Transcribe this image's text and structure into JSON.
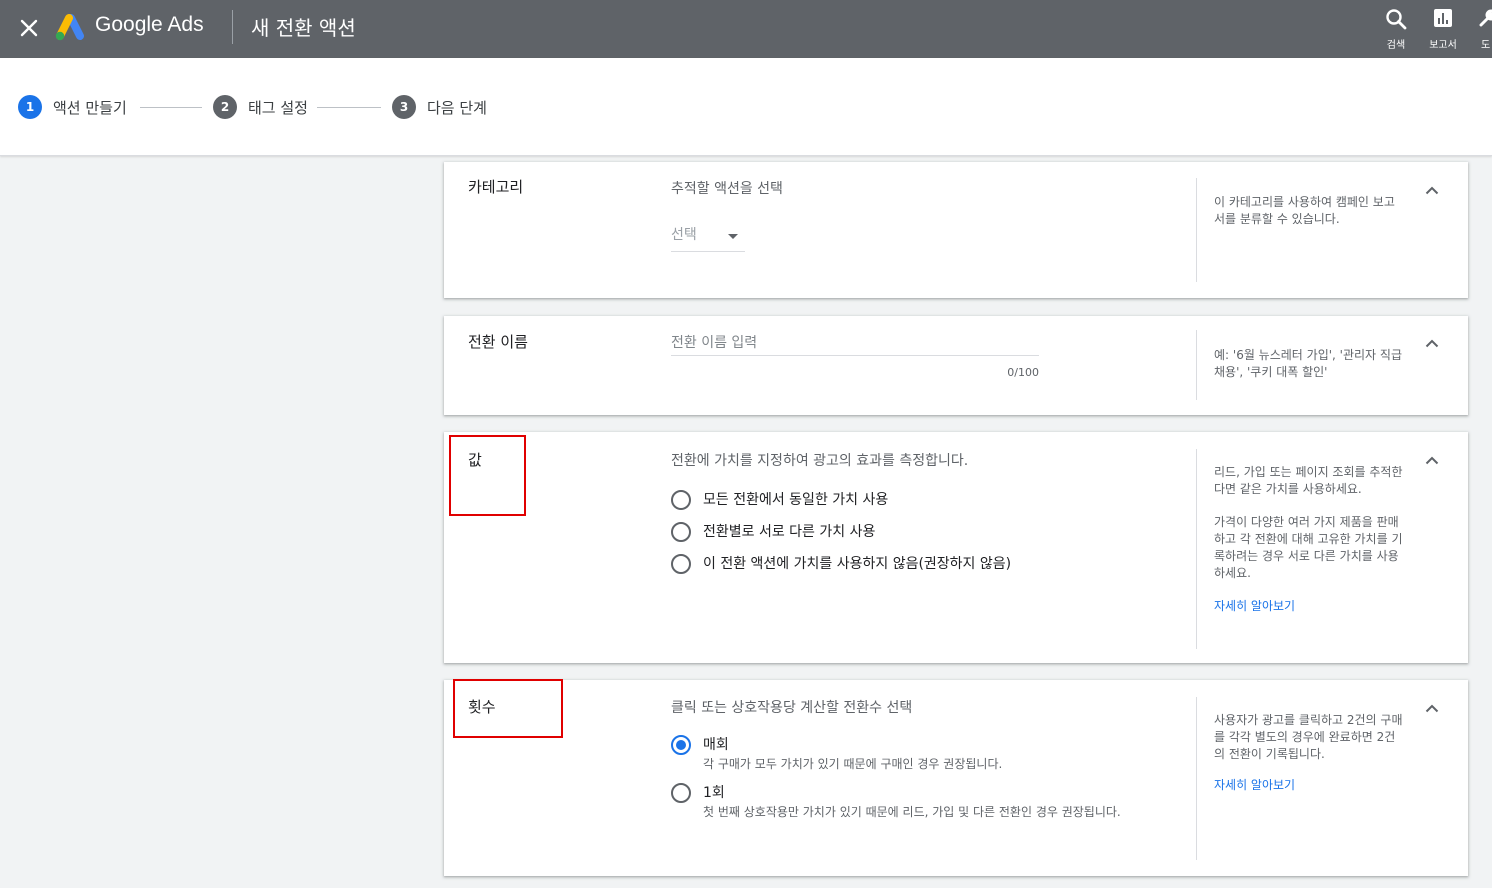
{
  "header": {
    "close_icon": "close-icon",
    "brand": "Google Ads",
    "page_title": "새 전환 액션",
    "tools": [
      {
        "icon": "search-icon",
        "label": "검색"
      },
      {
        "icon": "reports-icon",
        "label": "보고서"
      },
      {
        "icon": "tools-icon",
        "label": "도"
      }
    ]
  },
  "stepper": {
    "steps": [
      {
        "number": "1",
        "label": "액션 만들기",
        "active": true
      },
      {
        "number": "2",
        "label": "태그 설정",
        "active": false
      },
      {
        "number": "3",
        "label": "다음 단계",
        "active": false
      }
    ]
  },
  "category_card": {
    "title": "카테고리",
    "description": "추적할 액션을 선택",
    "select_value": "선택",
    "help": "이 카테고리를 사용하여 캠페인 보고서를 분류할 수 있습니다."
  },
  "name_card": {
    "title": "전환 이름",
    "placeholder": "전환 이름 입력",
    "counter": "0/100",
    "help": "예: '6월 뉴스레터 가입', '관리자 직급 채용', '쿠키 대폭 할인'"
  },
  "value_card": {
    "title": "값",
    "description": "전환에 가치를 지정하여 광고의 효과를 측정합니다.",
    "options": [
      {
        "label": "모든 전환에서 동일한 가치 사용",
        "checked": false
      },
      {
        "label": "전환별로 서로 다른 가치 사용",
        "checked": false
      },
      {
        "label": "이 전환 액션에 가치를 사용하지 않음(권장하지 않음)",
        "checked": false
      }
    ],
    "help_1": "리드, 가입 또는 페이지 조회를 추적한다면 같은 가치를 사용하세요.",
    "help_2": "가격이 다양한 여러 가지 제품을 판매하고 각 전환에 대해 고유한 가치를 기록하려는 경우 서로 다른 가치를 사용하세요.",
    "link": "자세히 알아보기"
  },
  "count_card": {
    "title": "횟수",
    "description": "클릭 또는 상호작용당 계산할 전환수 선택",
    "options": [
      {
        "label": "매회",
        "sub": "각 구매가 모두 가치가 있기 때문에 구매인 경우 권장됩니다.",
        "checked": true
      },
      {
        "label": "1회",
        "sub": "첫 번째 상호작용만 가치가 있기 때문에 리드, 가입 및 다른 전환인 경우 권장됩니다.",
        "checked": false
      }
    ],
    "help": "사용자가 광고를 클릭하고 2건의 구매를 각각 별도의 경우에 완료하면 2건의 전환이 기록됩니다.",
    "link": "자세히 알아보기"
  },
  "colors": {
    "header_bg": "#5f6368",
    "accent": "#1a73e8",
    "highlight_box": "#e00000"
  }
}
